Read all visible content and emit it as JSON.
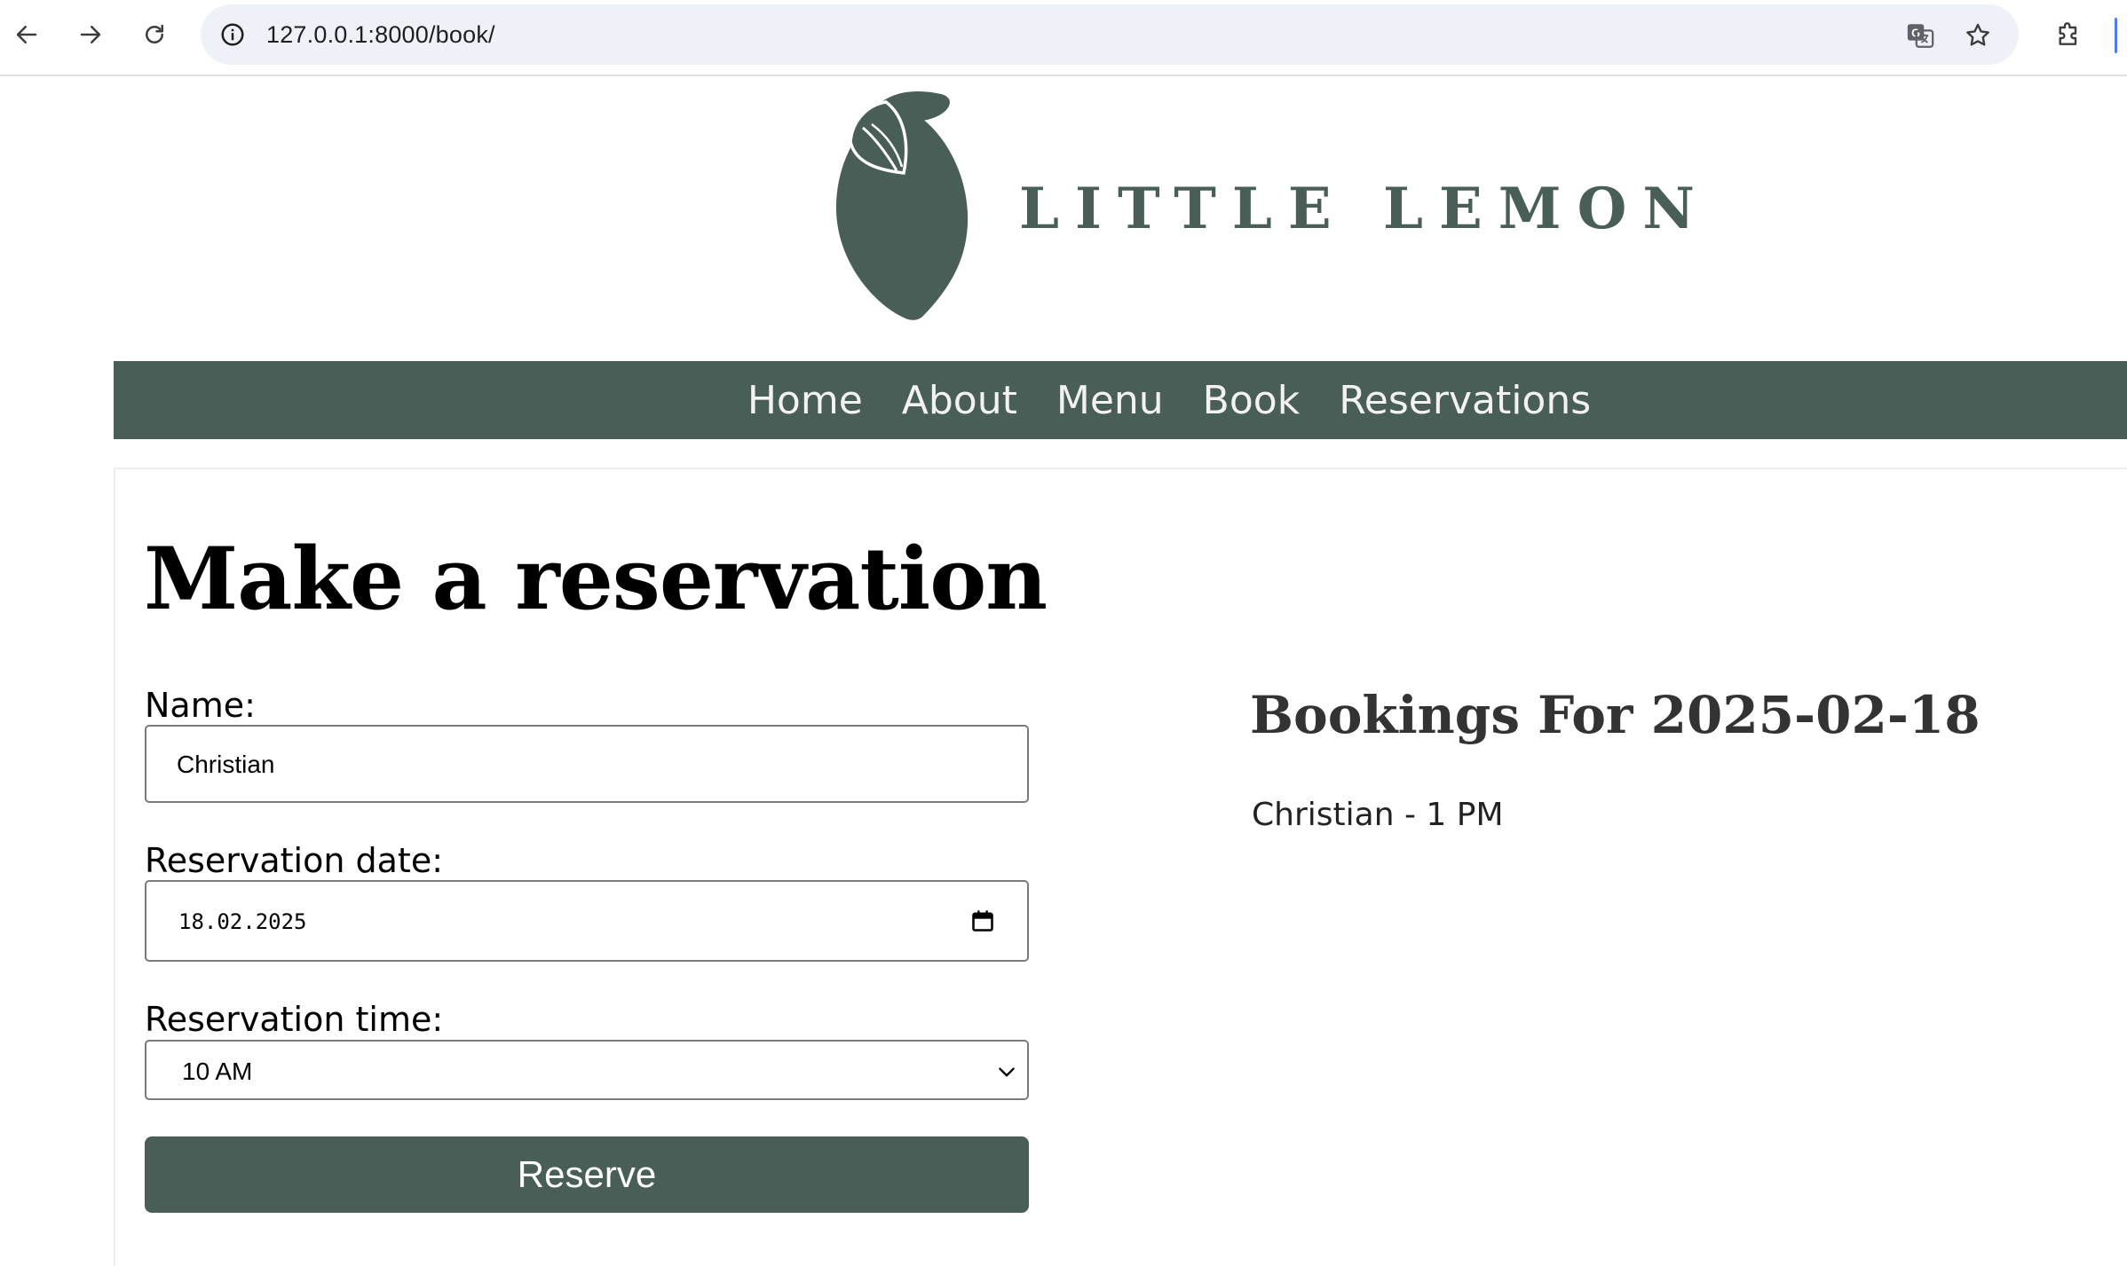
{
  "browser": {
    "url": "127.0.0.1:8000/book/"
  },
  "site": {
    "logo_text": "LITTLE LEMON",
    "brand_color": "#495e57"
  },
  "nav": {
    "items": [
      {
        "label": "Home"
      },
      {
        "label": "About"
      },
      {
        "label": "Menu"
      },
      {
        "label": "Book"
      },
      {
        "label": "Reservations"
      }
    ]
  },
  "form": {
    "title": "Make a reservation",
    "name_label": "Name:",
    "name_value": "Christian",
    "date_label": "Reservation date:",
    "date_value": "18.02.2025",
    "time_label": "Reservation time:",
    "time_value": "10 AM",
    "submit_label": "Reserve"
  },
  "bookings": {
    "title": "Bookings For 2025-02-18",
    "items": [
      {
        "text": "Christian - 1 PM"
      }
    ]
  }
}
